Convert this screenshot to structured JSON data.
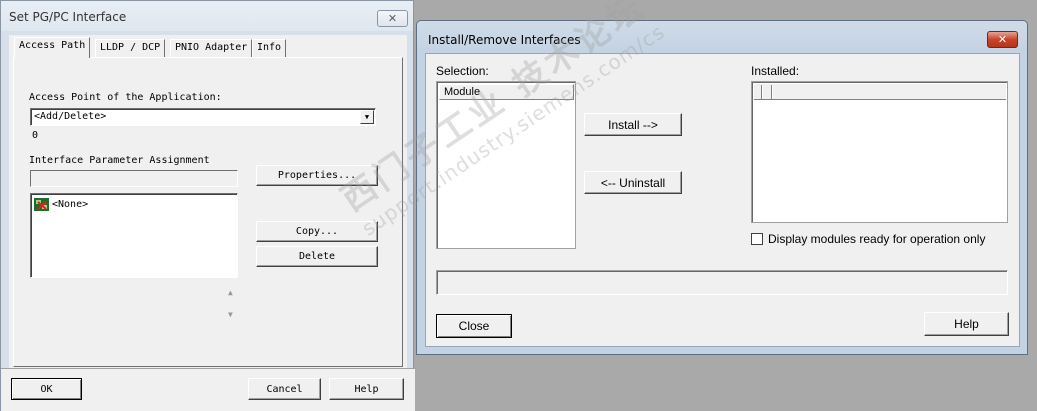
{
  "left_dialog": {
    "title": "Set PG/PC Interface",
    "close_glyph": "✕",
    "tabs": [
      {
        "label": "Access Path"
      },
      {
        "label": "LLDP / DCP"
      },
      {
        "label": "PNIO Adapter"
      },
      {
        "label": "Info"
      }
    ],
    "access_point_label": "Access Point of the Application:",
    "access_point_value": "<Add/Delete>",
    "access_point_extra": "0",
    "interface_label": "Interface Parameter Assignment",
    "interface_list": [
      "<None>"
    ],
    "properties_label": "Properties...",
    "copy_label": "Copy...",
    "delete_label": "Delete",
    "ok_label": "OK",
    "cancel_label": "Cancel",
    "help_label": "Help"
  },
  "right_dialog": {
    "title": "Install/Remove Interfaces",
    "close_glyph": "✕",
    "selection_label": "Selection:",
    "selection_header": "Module",
    "installed_label": "Installed:",
    "install_label": "Install -->",
    "uninstall_label": "<-- Uninstall",
    "display_checkbox_label": "Display modules ready for operation only",
    "display_checked": false,
    "close_label": "Close",
    "help_label": "Help"
  },
  "watermark": {
    "line1": "西门子工业 技术论坛",
    "line2": "support.industry.siemens.com/cs"
  },
  "colors": {
    "background": "#a9a9a9",
    "dialog_face": "#f0f0f0",
    "close_button_red": "#c9432a"
  }
}
